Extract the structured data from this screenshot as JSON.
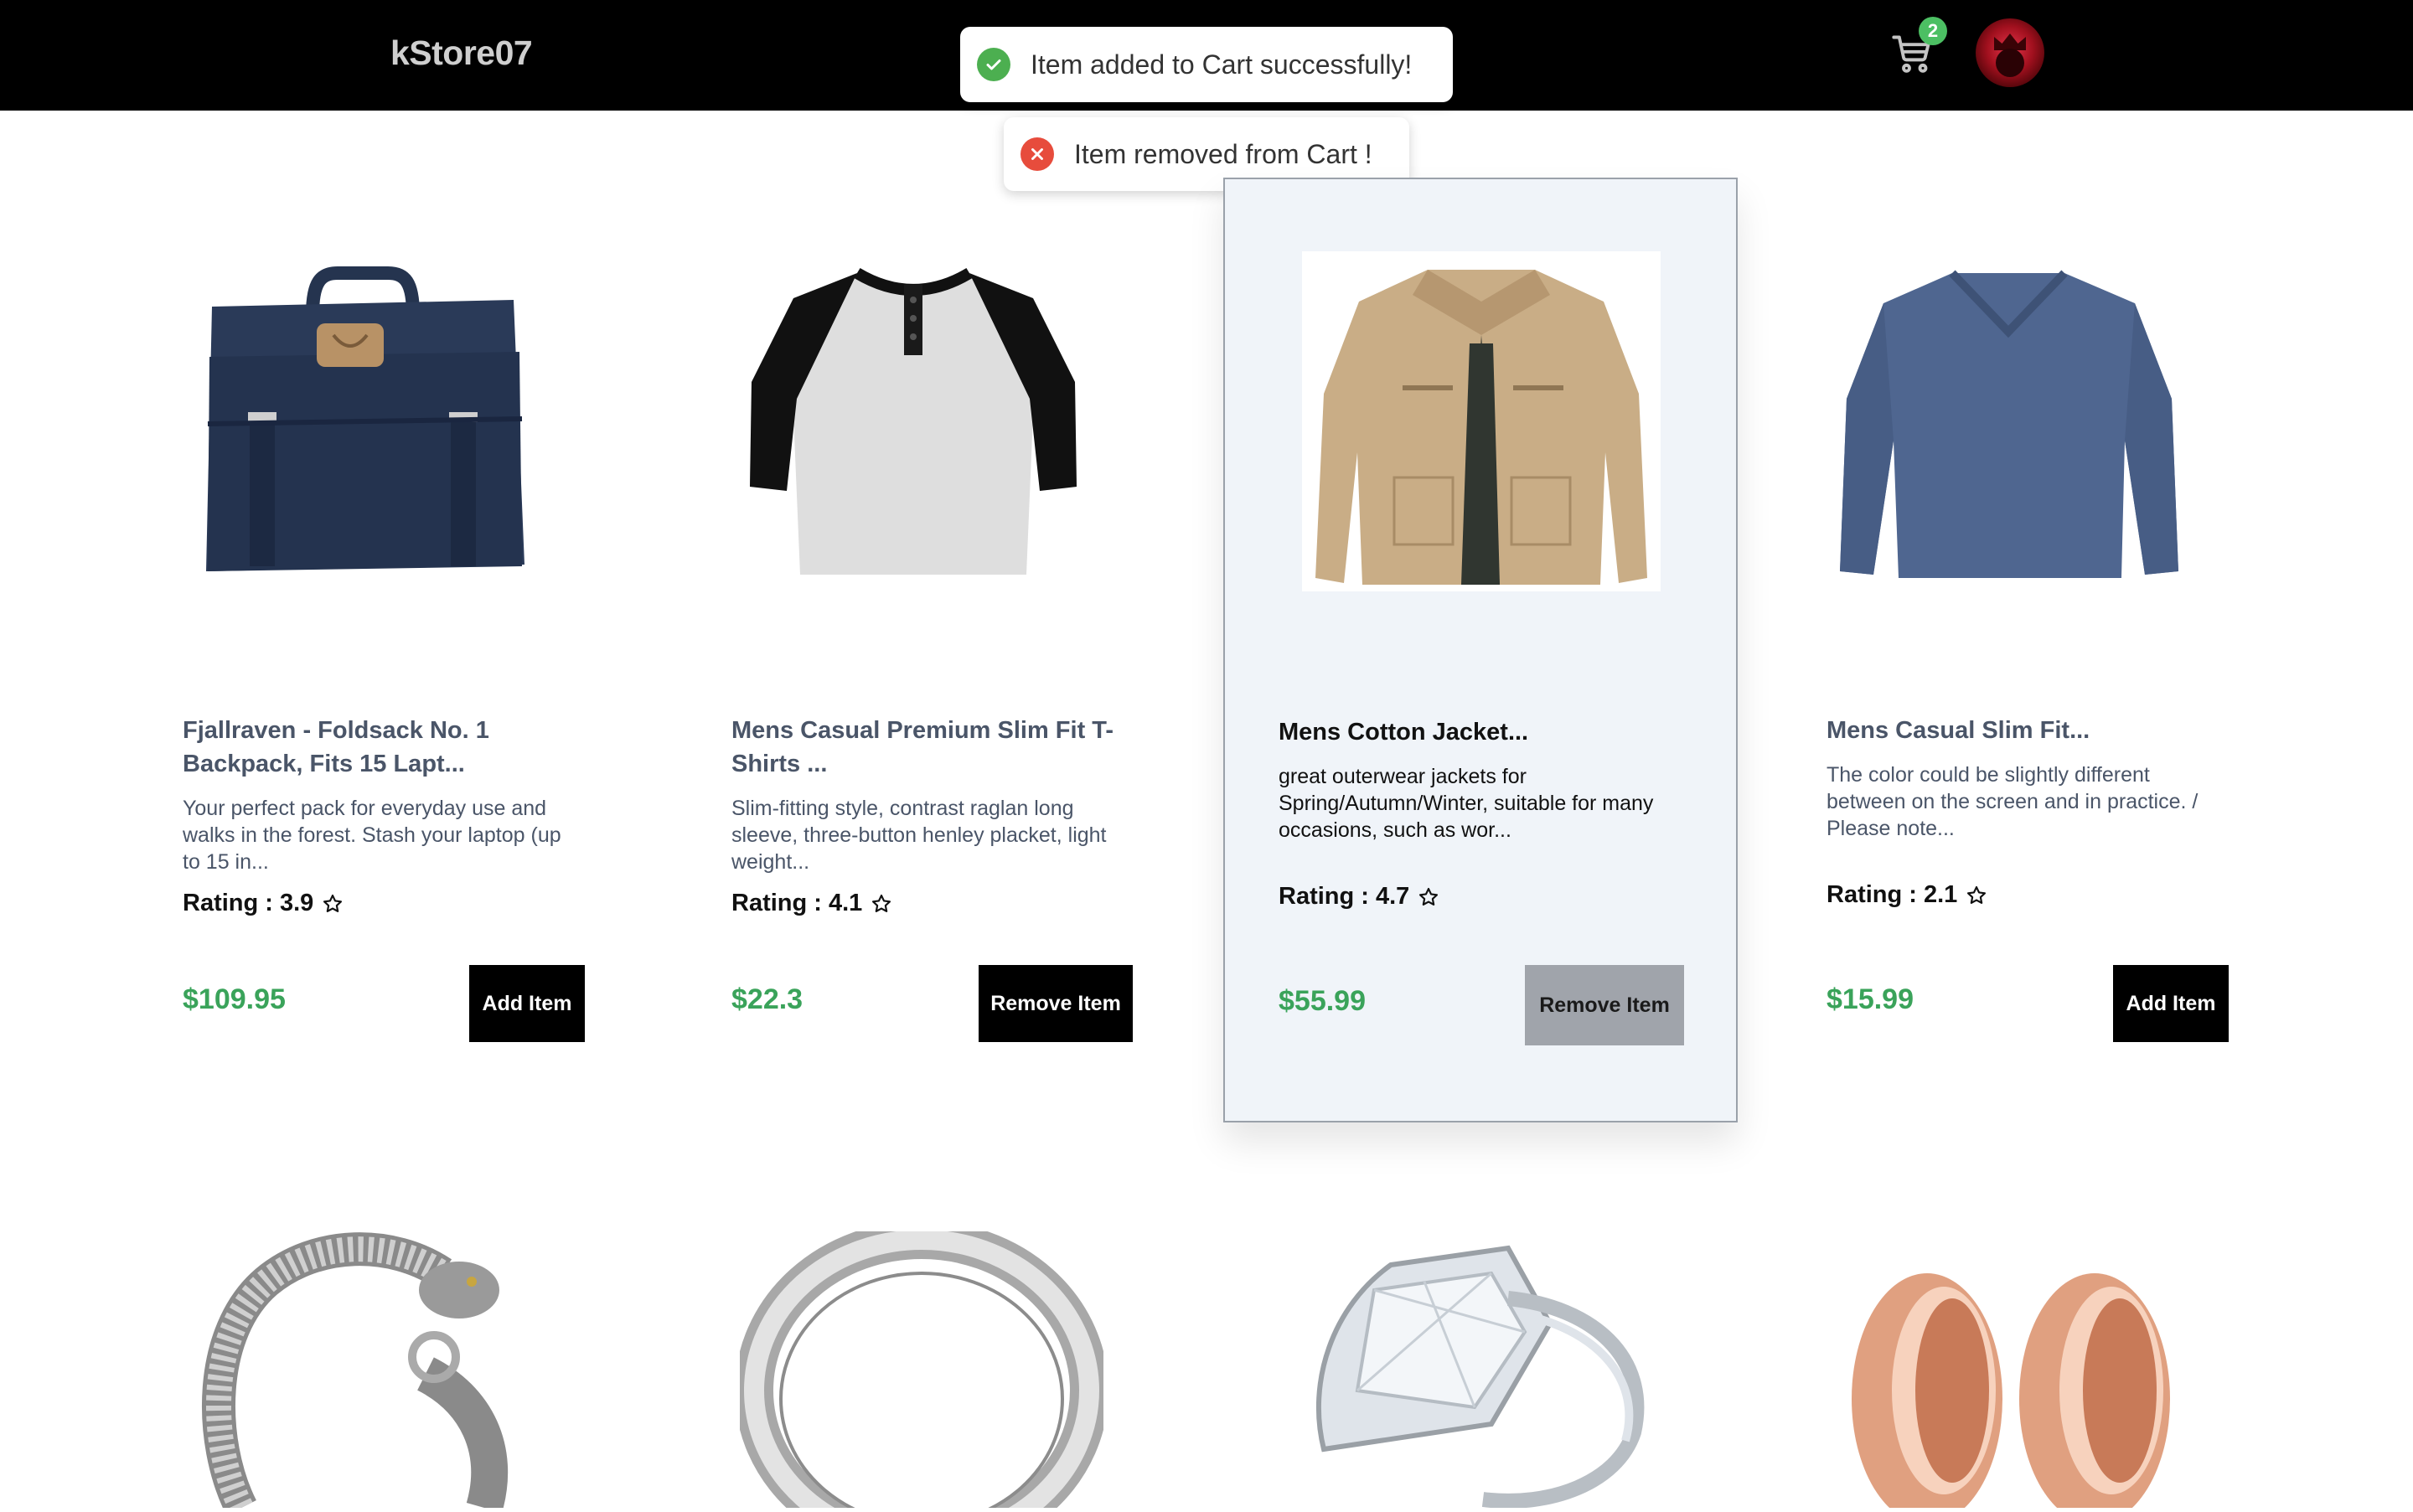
{
  "header": {
    "brand": "kStore07",
    "cart_count": "2"
  },
  "toasts": {
    "success": "Item added to Cart successfully!",
    "error": "Item removed from Cart !"
  },
  "products": [
    {
      "title": "Fjallraven - Foldsack No. 1 Backpack, Fits 15 Lapt...",
      "description": "Your perfect pack for everyday use and walks in the forest. Stash your laptop (up to 15 in...",
      "rating": "Rating : 3.9",
      "price": "$109.95",
      "button": "Add Item",
      "image": "backpack"
    },
    {
      "title": "Mens Casual Premium Slim Fit T-Shirts ...",
      "description": "Slim-fitting style, contrast raglan long sleeve, three-button henley placket, light weight...",
      "rating": "Rating : 4.1",
      "price": "$22.3",
      "button": "Remove Item",
      "image": "raglan-tshirt"
    },
    {
      "title": "Mens Cotton Jacket...",
      "description": "great outerwear jackets for Spring/Autumn/Winter, suitable for many occasions, such as wor...",
      "rating": "Rating : 4.7",
      "price": "$55.99",
      "button": "Remove Item",
      "image": "cotton-jacket"
    },
    {
      "title": "Mens Casual Slim Fit...",
      "description": "The color could be slightly different between on the screen and in practice. / Please note...",
      "rating": "Rating : 2.1",
      "price": "$15.99",
      "button": "Add Item",
      "image": "long-sleeve-shirt"
    }
  ],
  "products_row2": [
    {
      "image": "dragon-bracelet"
    },
    {
      "image": "silver-ring"
    },
    {
      "image": "diamond-ring"
    },
    {
      "image": "rose-gold-tunnels"
    }
  ],
  "colors": {
    "header_bg": "#000000",
    "price": "#3aa35a",
    "badge": "#4cbf63",
    "success": "#4caf50",
    "error": "#e74c3c",
    "hover_card_bg": "#f0f4f9"
  }
}
